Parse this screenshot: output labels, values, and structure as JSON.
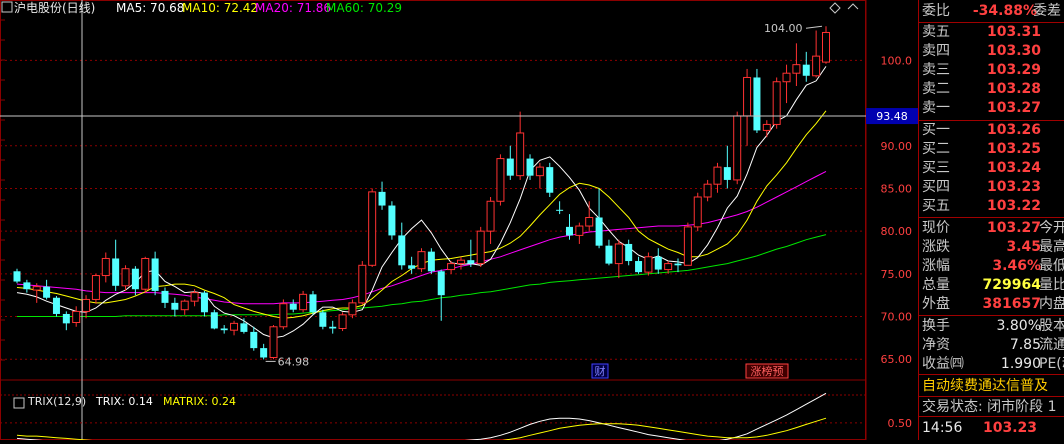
{
  "header": {
    "title": "沪电股份(日线)",
    "ma5": "MA5: 70.68",
    "ma10": "MA10: 72.42",
    "ma20": "MA20: 71.86",
    "ma60": "MA60: 70.29",
    "indicator_label": "TRIX(12,9)",
    "trix_value": "TRIX: 0.14",
    "matrix_value": "MATRIX: 0.24"
  },
  "annotations": {
    "high_label": "104.00",
    "low_label": "64.98",
    "crosshair_price": "93.48",
    "marker_cai": "财",
    "marker_zhangting": "涨榜预"
  },
  "colors": {
    "up": "#ff3232",
    "down": "#54ffff",
    "ma5": "#ffffff",
    "ma10": "#ffff00",
    "ma20": "#ff00ff",
    "ma60": "#00e600",
    "grid": "#8b0000",
    "axis_text": "#ff4040"
  },
  "quote": {
    "weibi": {
      "label": "委比",
      "value": "-34.88%",
      "extra": "委差"
    },
    "asks": [
      {
        "label": "卖五",
        "price": "103.31"
      },
      {
        "label": "卖四",
        "price": "103.30"
      },
      {
        "label": "卖三",
        "price": "103.29"
      },
      {
        "label": "卖二",
        "price": "103.28"
      },
      {
        "label": "卖一",
        "price": "103.27"
      }
    ],
    "bids": [
      {
        "label": "买一",
        "price": "103.26"
      },
      {
        "label": "买二",
        "price": "103.25"
      },
      {
        "label": "买三",
        "price": "103.24"
      },
      {
        "label": "买四",
        "price": "103.23"
      },
      {
        "label": "买五",
        "price": "103.22"
      }
    ],
    "stats": [
      {
        "label": "现价",
        "value": "103.27",
        "label2": "今开",
        "color": "red"
      },
      {
        "label": "涨跌",
        "value": "3.45",
        "label2": "最高",
        "color": "red"
      },
      {
        "label": "涨幅",
        "value": "3.46%",
        "label2": "最低",
        "color": "red"
      },
      {
        "label": "总量",
        "value": "729964",
        "label2": "量比",
        "color": "yellow"
      },
      {
        "label": "外盘",
        "value": "381657",
        "label2": "内盘",
        "color": "red"
      }
    ],
    "stats2": [
      {
        "label": "换手",
        "value": "3.80%",
        "label2": "股本"
      },
      {
        "label": "净资",
        "value": "7.85",
        "label2": "流通"
      },
      {
        "label": "收益㈣",
        "value": "1.990",
        "label2": "PE(动"
      }
    ],
    "banner": "自动续费通达信普及",
    "status": "交易状态: 闭市阶段 1",
    "last_time": "14:56",
    "last_price": "103.23"
  },
  "chart_data": [
    {
      "type": "candlestick",
      "title": "沪电股份(日线)",
      "yticks": [
        65.0,
        70.0,
        75.0,
        80.0,
        85.0,
        90.0,
        100.0
      ],
      "ylim": [
        62.8,
        105.2
      ],
      "high": 104.0,
      "low": 64.98,
      "ohlc": [
        [
          75.3,
          75.6,
          73.9,
          74.1
        ],
        [
          74.0,
          74.3,
          72.8,
          73.2
        ],
        [
          73.1,
          73.9,
          71.6,
          73.5
        ],
        [
          73.5,
          74.3,
          72.0,
          72.2
        ],
        [
          72.2,
          72.4,
          70.0,
          70.3
        ],
        [
          70.3,
          70.6,
          68.4,
          69.2
        ],
        [
          69.3,
          71.2,
          68.8,
          70.6
        ],
        [
          70.6,
          72.5,
          69.8,
          72.0
        ],
        [
          72.0,
          75.0,
          71.5,
          74.8
        ],
        [
          74.8,
          77.5,
          74.0,
          76.8
        ],
        [
          76.8,
          79.0,
          73.0,
          73.6
        ],
        [
          73.6,
          76.0,
          73.0,
          75.6
        ],
        [
          75.6,
          75.9,
          72.5,
          73.2
        ],
        [
          73.2,
          77.0,
          72.8,
          76.8
        ],
        [
          76.8,
          77.6,
          72.5,
          73.0
        ],
        [
          73.0,
          73.4,
          71.0,
          71.6
        ],
        [
          71.6,
          72.2,
          70.0,
          70.8
        ],
        [
          70.8,
          72.0,
          70.2,
          71.8
        ],
        [
          71.8,
          73.2,
          71.2,
          72.8
        ],
        [
          72.8,
          73.0,
          70.0,
          70.5
        ],
        [
          70.5,
          70.8,
          68.5,
          68.6
        ],
        [
          68.6,
          69.0,
          68.0,
          68.4
        ],
        [
          68.4,
          69.5,
          67.8,
          69.2
        ],
        [
          69.2,
          69.8,
          68.0,
          68.2
        ],
        [
          68.2,
          68.8,
          66.0,
          66.3
        ],
        [
          66.3,
          66.8,
          64.98,
          65.2
        ],
        [
          65.2,
          69.0,
          65.0,
          68.8
        ],
        [
          68.8,
          72.0,
          68.5,
          71.5
        ],
        [
          71.5,
          72.0,
          70.5,
          70.8
        ],
        [
          70.8,
          73.0,
          70.5,
          72.6
        ],
        [
          72.6,
          73.0,
          70.2,
          70.5
        ],
        [
          70.5,
          70.8,
          68.5,
          68.8
        ],
        [
          68.8,
          69.5,
          68.0,
          68.6
        ],
        [
          68.6,
          70.5,
          68.3,
          70.2
        ],
        [
          70.2,
          72.0,
          69.8,
          71.6
        ],
        [
          71.6,
          76.5,
          71.4,
          76.0
        ],
        [
          76.0,
          85.0,
          75.8,
          84.6
        ],
        [
          84.6,
          85.8,
          82.5,
          83.0
        ],
        [
          83.0,
          83.5,
          79.0,
          79.5
        ],
        [
          79.5,
          81.0,
          75.5,
          76.0
        ],
        [
          76.0,
          77.0,
          75.0,
          75.6
        ],
        [
          75.6,
          78.0,
          75.2,
          77.6
        ],
        [
          77.6,
          78.0,
          75.0,
          75.3
        ],
        [
          75.3,
          75.5,
          69.5,
          72.5
        ],
        [
          75.5,
          76.5,
          75.0,
          76.2
        ],
        [
          76.2,
          77.0,
          75.5,
          76.6
        ],
        [
          76.6,
          79.0,
          75.8,
          76.2
        ],
        [
          76.2,
          80.5,
          75.8,
          80.0
        ],
        [
          80.0,
          84.0,
          78.5,
          83.5
        ],
        [
          83.5,
          89.0,
          83.0,
          88.5
        ],
        [
          88.5,
          90.0,
          86.0,
          86.5
        ],
        [
          86.5,
          94.0,
          86.0,
          91.5
        ],
        [
          88.5,
          89.0,
          86.0,
          86.5
        ],
        [
          86.5,
          88.0,
          85.0,
          87.5
        ],
        [
          87.5,
          88.0,
          84.0,
          84.5
        ],
        [
          82.5,
          83.5,
          82.0,
          82.4
        ],
        [
          80.5,
          82.0,
          79.0,
          79.5
        ],
        [
          79.5,
          81.0,
          78.5,
          80.6
        ],
        [
          80.6,
          83.5,
          80.0,
          81.6
        ],
        [
          81.6,
          85.0,
          78.0,
          78.3
        ],
        [
          78.3,
          79.0,
          76.0,
          76.2
        ],
        [
          76.2,
          79.0,
          74.5,
          78.5
        ],
        [
          78.5,
          79.0,
          76.0,
          76.5
        ],
        [
          76.5,
          77.0,
          75.0,
          75.2
        ],
        [
          75.2,
          77.5,
          74.8,
          77.0
        ],
        [
          77.0,
          78.0,
          75.0,
          75.5
        ],
        [
          75.5,
          76.5,
          75.0,
          76.2
        ],
        [
          76.2,
          76.8,
          75.2,
          76.0
        ],
        [
          76.0,
          81.0,
          76.0,
          80.5
        ],
        [
          80.5,
          84.5,
          80.0,
          84.0
        ],
        [
          84.0,
          86.0,
          83.5,
          85.5
        ],
        [
          85.5,
          88.0,
          84.5,
          87.5
        ],
        [
          87.5,
          90.0,
          85.0,
          86.0
        ],
        [
          86.0,
          94.0,
          85.5,
          93.5
        ],
        [
          93.5,
          99.0,
          90.0,
          98.0
        ],
        [
          98.0,
          99.0,
          91.5,
          91.8
        ],
        [
          91.8,
          93.0,
          91.0,
          92.5
        ],
        [
          92.5,
          98.0,
          92.0,
          97.5
        ],
        [
          97.5,
          99.5,
          95.0,
          98.5
        ],
        [
          98.5,
          102.0,
          97.0,
          99.5
        ],
        [
          99.5,
          101.0,
          97.5,
          98.2
        ],
        [
          98.2,
          103.5,
          98.0,
          100.5
        ],
        [
          99.8,
          104.0,
          99.6,
          103.27
        ]
      ],
      "ma5": [
        72.8,
        72.6,
        72.3,
        71.8,
        71.4,
        71.0,
        70.6,
        70.5,
        71.0,
        71.9,
        72.6,
        73.1,
        74.0,
        75.2,
        75.4,
        74.1,
        73.5,
        72.8,
        72.9,
        72.7,
        71.2,
        70.4,
        70.1,
        69.5,
        68.7,
        67.9,
        67.5,
        67.7,
        68.3,
        69.1,
        70.2,
        71.1,
        71.1,
        70.6,
        70.5,
        70.8,
        73.1,
        75.8,
        77.5,
        79.1,
        80.3,
        81.3,
        79.8,
        77.9,
        76.3,
        76.1,
        76.2,
        76.0,
        76.7,
        78.6,
        81.0,
        83.8,
        87.1,
        88.3,
        88.7,
        87.6,
        86.3,
        84.8,
        82.7,
        81.5,
        80.1,
        78.8,
        78.1,
        77.2,
        76.7,
        77.1,
        76.5,
        76.4,
        76.2,
        76.9,
        78.4,
        80.4,
        82.7,
        84.1,
        86.7,
        89.8,
        91.2,
        92.9,
        93.5,
        95.4,
        97.1,
        97.6,
        99.3
      ],
      "ma10": [
        73.4,
        73.3,
        73.1,
        72.9,
        72.7,
        72.4,
        72.1,
        71.8,
        71.6,
        71.6,
        71.8,
        72.0,
        72.4,
        72.9,
        73.5,
        73.6,
        73.8,
        73.8,
        73.6,
        73.1,
        72.7,
        72.2,
        71.4,
        71.0,
        70.6,
        70.3,
        70.0,
        69.8,
        69.9,
        70.1,
        70.4,
        70.7,
        70.9,
        71.0,
        71.0,
        71.3,
        72.1,
        73.1,
        74.1,
        74.8,
        75.6,
        76.2,
        76.6,
        76.7,
        76.8,
        77.0,
        77.2,
        77.4,
        77.6,
        78.0,
        78.6,
        79.4,
        80.6,
        81.9,
        83.1,
        84.3,
        85.1,
        85.6,
        85.4,
        85.0,
        84.0,
        82.8,
        81.6,
        80.0,
        79.1,
        78.5,
        77.9,
        77.5,
        77.0,
        77.0,
        77.3,
        77.9,
        78.5,
        79.6,
        81.3,
        83.5,
        85.3,
        86.6,
        88.0,
        89.7,
        91.3,
        92.6,
        94.1
      ],
      "ma20": [
        73.8,
        73.7,
        73.6,
        73.5,
        73.4,
        73.3,
        73.2,
        73.0,
        72.9,
        72.8,
        72.8,
        72.8,
        72.8,
        72.8,
        72.8,
        72.7,
        72.6,
        72.5,
        72.3,
        72.1,
        71.9,
        71.7,
        71.6,
        71.5,
        71.5,
        71.5,
        71.5,
        71.6,
        71.6,
        71.6,
        71.7,
        71.8,
        71.9,
        72.0,
        72.2,
        72.5,
        72.9,
        73.3,
        73.6,
        74.0,
        74.4,
        74.8,
        75.2,
        75.4,
        75.6,
        75.9,
        76.1,
        76.4,
        76.7,
        77.0,
        77.4,
        77.8,
        78.2,
        78.6,
        79.0,
        79.3,
        79.5,
        79.7,
        79.9,
        80.0,
        80.1,
        80.2,
        80.3,
        80.4,
        80.5,
        80.6,
        80.6,
        80.6,
        80.7,
        80.8,
        81.0,
        81.3,
        81.6,
        81.9,
        82.3,
        82.8,
        83.4,
        84.0,
        84.6,
        85.2,
        85.8,
        86.4,
        87.0
      ],
      "ma60": [
        70.0,
        70.0,
        70.0,
        70.0,
        70.0,
        70.0,
        70.0,
        70.0,
        70.0,
        70.0,
        70.0,
        70.1,
        70.1,
        70.1,
        70.1,
        70.1,
        70.1,
        70.1,
        70.1,
        70.1,
        70.1,
        70.2,
        70.2,
        70.2,
        70.2,
        70.2,
        70.2,
        70.3,
        70.3,
        70.4,
        70.5,
        70.6,
        70.7,
        70.8,
        70.9,
        71.0,
        71.1,
        71.2,
        71.4,
        71.5,
        71.7,
        71.8,
        72.0,
        72.2,
        72.3,
        72.5,
        72.6,
        72.8,
        72.9,
        73.1,
        73.3,
        73.5,
        73.7,
        73.8,
        74.0,
        74.1,
        74.2,
        74.3,
        74.4,
        74.5,
        74.6,
        74.7,
        74.8,
        74.9,
        75.0,
        75.1,
        75.2,
        75.3,
        75.4,
        75.6,
        75.8,
        76.0,
        76.2,
        76.5,
        76.8,
        77.1,
        77.5,
        77.9,
        78.2,
        78.6,
        79.0,
        79.3,
        79.6
      ]
    },
    {
      "type": "line",
      "title": "TRIX(12,9)",
      "yticks": [
        0.5
      ],
      "series": [
        {
          "name": "TRIX",
          "values": [
            0.3,
            0.29,
            0.28,
            0.27,
            0.25,
            0.23,
            0.21,
            0.19,
            0.18,
            0.17,
            0.16,
            0.16,
            0.16,
            0.17,
            0.18,
            0.18,
            0.17,
            0.16,
            0.15,
            0.14,
            0.12,
            0.1,
            0.08,
            0.06,
            0.04,
            0.02,
            0.01,
            0.0,
            0.0,
            0.01,
            0.02,
            0.03,
            0.04,
            0.04,
            0.05,
            0.07,
            0.1,
            0.14,
            0.18,
            0.21,
            0.24,
            0.26,
            0.27,
            0.27,
            0.27,
            0.27,
            0.28,
            0.29,
            0.31,
            0.34,
            0.38,
            0.43,
            0.48,
            0.52,
            0.55,
            0.56,
            0.56,
            0.55,
            0.53,
            0.5,
            0.47,
            0.44,
            0.41,
            0.38,
            0.35,
            0.33,
            0.31,
            0.29,
            0.27,
            0.26,
            0.26,
            0.27,
            0.29,
            0.32,
            0.36,
            0.42,
            0.48,
            0.54,
            0.6,
            0.67,
            0.74,
            0.81,
            0.88
          ]
        },
        {
          "name": "MATRIX",
          "values": [
            0.34,
            0.33,
            0.33,
            0.32,
            0.31,
            0.3,
            0.29,
            0.28,
            0.27,
            0.26,
            0.25,
            0.24,
            0.23,
            0.22,
            0.21,
            0.2,
            0.19,
            0.18,
            0.18,
            0.17,
            0.17,
            0.16,
            0.15,
            0.14,
            0.13,
            0.12,
            0.11,
            0.1,
            0.09,
            0.08,
            0.07,
            0.06,
            0.05,
            0.05,
            0.05,
            0.05,
            0.06,
            0.07,
            0.08,
            0.1,
            0.12,
            0.14,
            0.16,
            0.18,
            0.2,
            0.22,
            0.23,
            0.24,
            0.25,
            0.27,
            0.29,
            0.31,
            0.34,
            0.37,
            0.4,
            0.43,
            0.45,
            0.47,
            0.48,
            0.49,
            0.49,
            0.49,
            0.48,
            0.47,
            0.45,
            0.43,
            0.41,
            0.39,
            0.37,
            0.35,
            0.33,
            0.32,
            0.31,
            0.31,
            0.31,
            0.32,
            0.34,
            0.37,
            0.4,
            0.44,
            0.48,
            0.52,
            0.56
          ]
        }
      ]
    }
  ]
}
